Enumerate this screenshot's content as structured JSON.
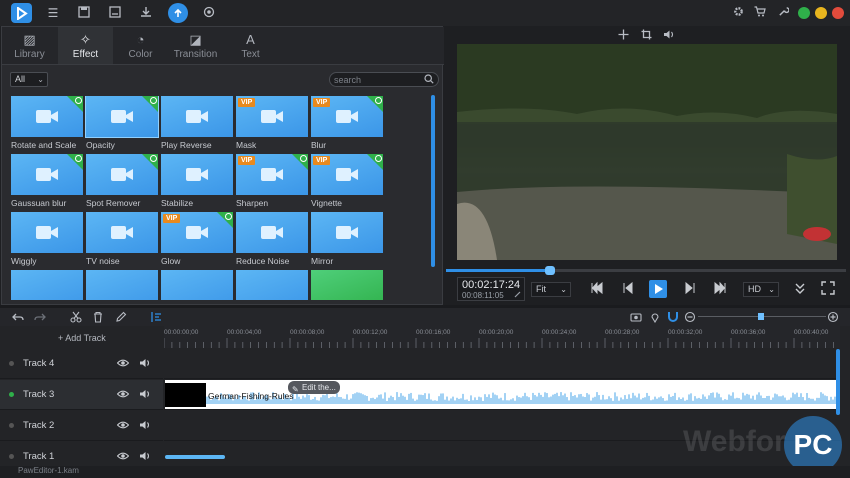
{
  "app": {
    "status_file": "PawEditor-1.kam"
  },
  "tabs": [
    {
      "label": "Library",
      "icon": "library-icon"
    },
    {
      "label": "Effect",
      "icon": "effect-wand-icon"
    },
    {
      "label": "Color",
      "icon": "color-palette-icon"
    },
    {
      "label": "Transition",
      "icon": "transition-icon"
    },
    {
      "label": "Text",
      "icon": "text-icon"
    }
  ],
  "filter": {
    "value": "All"
  },
  "search": {
    "placeholder": "search"
  },
  "effects": [
    {
      "label": "Rotate and Scale",
      "vip": false,
      "badge": true
    },
    {
      "label": "Opacity",
      "vip": false,
      "badge": true
    },
    {
      "label": "Play Reverse",
      "vip": false,
      "badge": false
    },
    {
      "label": "Mask",
      "vip": true,
      "badge": false
    },
    {
      "label": "Blur",
      "vip": true,
      "badge": true
    },
    {
      "label": "Gaussuan blur",
      "vip": false,
      "badge": true
    },
    {
      "label": "Spot Remover",
      "vip": false,
      "badge": true
    },
    {
      "label": "Stabilize",
      "vip": false,
      "badge": false
    },
    {
      "label": "Sharpen",
      "vip": true,
      "badge": true
    },
    {
      "label": "Vignette",
      "vip": true,
      "badge": true
    },
    {
      "label": "Wiggly",
      "vip": false,
      "badge": false
    },
    {
      "label": "TV noise",
      "vip": false,
      "badge": false
    },
    {
      "label": "Glow",
      "vip": true,
      "badge": true
    },
    {
      "label": "Reduce Noise",
      "vip": false,
      "badge": false
    },
    {
      "label": "Mirror",
      "vip": false,
      "badge": false
    }
  ],
  "vip_label": "VIP",
  "player": {
    "current_time": "00:02:17:24",
    "total_time": "00:08:11:05",
    "fit_value": "Fit",
    "quality_value": "HD",
    "progress": 0.26
  },
  "timeline": {
    "add_track_label": "+ Add Track",
    "ruler": [
      "00:00:00;00",
      "00:00:04;00",
      "00:00:08;00",
      "00:00:12;00",
      "00:00:16;00",
      "00:00:20;00",
      "00:00:24;00",
      "00:00:28;00",
      "00:00:32;00",
      "00:00:36;00",
      "00:00:40;00"
    ],
    "tracks": [
      {
        "name": "Track 4",
        "active": false
      },
      {
        "name": "Track 3",
        "active": true
      },
      {
        "name": "Track 2",
        "active": false
      },
      {
        "name": "Track 1",
        "active": false
      }
    ],
    "clip_name": "German-Fishing-Rules",
    "edit_label": "Edit the..."
  },
  "watermark": {
    "text": "Webfor",
    "badge": "PC"
  },
  "colors": {
    "accent": "#2f8fe6",
    "vip": "#e88a1e",
    "free_badge": "#2fb04a"
  }
}
